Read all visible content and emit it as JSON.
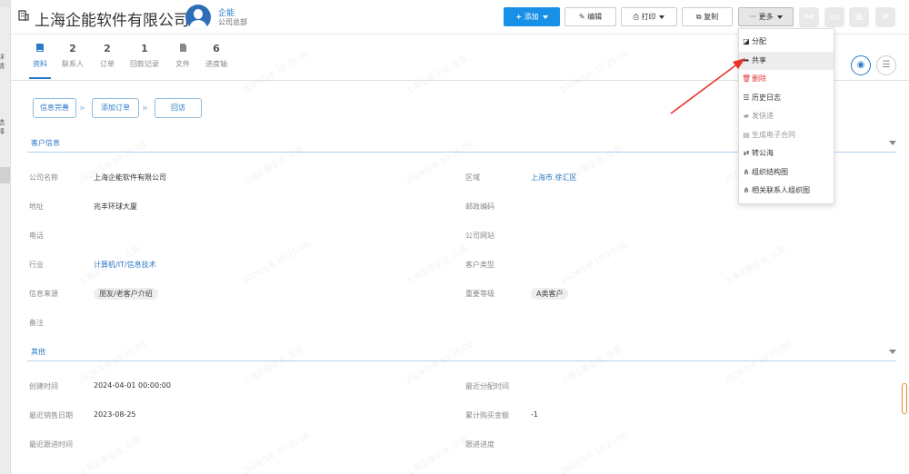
{
  "left_strip": {
    "frag1": "详情",
    "frag2": "选择"
  },
  "header": {
    "title": "上海企能软件有限公司",
    "owner_name": "企能",
    "owner_dept": "公司总部",
    "btn_add": "添加",
    "btn_edit": "编辑",
    "btn_print": "打印",
    "btn_copy": "复制",
    "btn_more": "更多"
  },
  "tabs": [
    {
      "count": "",
      "label": "资料"
    },
    {
      "count": "2",
      "label": "联系人"
    },
    {
      "count": "2",
      "label": "订单"
    },
    {
      "count": "1",
      "label": "回款记录"
    },
    {
      "count": "",
      "label": "文件"
    },
    {
      "count": "6",
      "label": "进度轴"
    }
  ],
  "steps": [
    "信息完善",
    "添加订单",
    "回访"
  ],
  "sections": {
    "customer": "客户信息",
    "other": "其他"
  },
  "fields": {
    "company_name_label": "公司名称",
    "company_name": "上海企能软件有限公司",
    "region_label": "区域",
    "region": "上海市.徐汇区",
    "address_label": "地址",
    "address": "兆丰环球大厦",
    "postcode_label": "邮政编码",
    "phone_label": "电话",
    "website_label": "公司网站",
    "industry_label": "行业",
    "industry": "计算机/IT/信息技术",
    "ctype_label": "客户类型",
    "source_label": "信息来源",
    "source": "朋友/老客户介绍",
    "level_label": "重要等级",
    "level": "A类客户",
    "remark_label": "备注",
    "created_label": "创建时间",
    "created": "2024-04-01 00:00:00",
    "assign_label": "最近分配时间",
    "lastsale_label": "最近销售日期",
    "lastsale": "2023-08-25",
    "total_label": "累计购买金额",
    "total": "-1",
    "follow_label": "最近跟进时间",
    "progress_label": "跟进进度"
  },
  "watermark": "2024/5/6 10:25:06",
  "watermark2": "上海企能企业_企能",
  "more_menu": [
    {
      "label": "分配",
      "icon": "assign-icon",
      "style": "normal"
    },
    {
      "label": "共享",
      "icon": "share-icon",
      "style": "hl"
    },
    {
      "label": "删除",
      "icon": "trash-icon",
      "style": "danger"
    },
    {
      "label": "历史日志",
      "icon": "list-icon",
      "style": "normal"
    },
    {
      "label": "发快递",
      "icon": "truck-icon",
      "style": "muted"
    },
    {
      "label": "生成电子合同",
      "icon": "file-icon",
      "style": "muted"
    },
    {
      "label": "转公海",
      "icon": "retweet-icon",
      "style": "normal"
    },
    {
      "label": "组织结构图",
      "icon": "sitemap-icon",
      "style": "normal"
    },
    {
      "label": "相关联系人组织图",
      "icon": "sitemap-icon",
      "style": "normal"
    }
  ],
  "colors": {
    "primary": "#1890e8",
    "link": "#2a7ac7",
    "danger": "#e0393e",
    "arrow": "#e8322a"
  }
}
